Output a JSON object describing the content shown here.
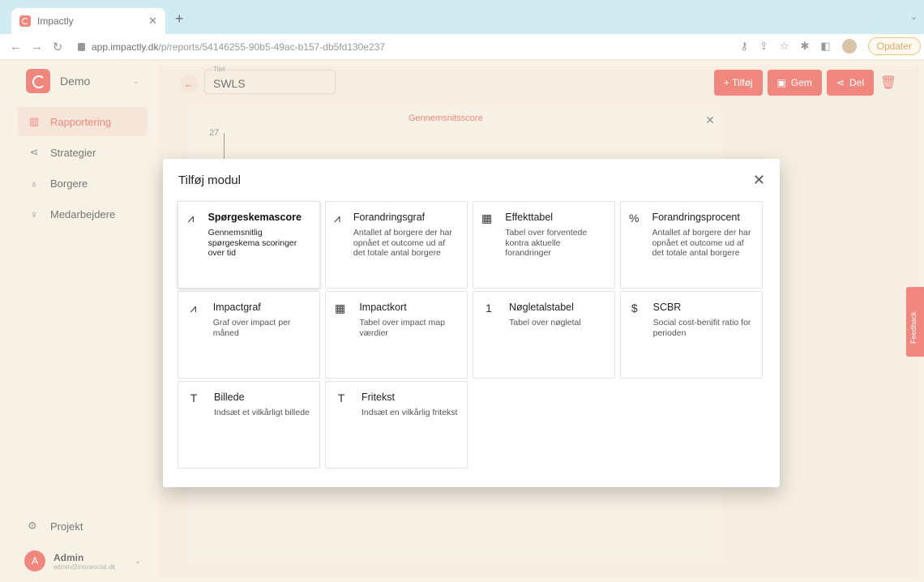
{
  "browser": {
    "tab_title": "Impactly",
    "url_host": "app.impactly.dk",
    "url_path": "/p/reports/54146255-90b5-49ac-b157-db5fd130e237",
    "update_label": "Opdater"
  },
  "sidebar": {
    "org_name": "Demo",
    "items": [
      {
        "label": "Rapportering",
        "icon": "report-icon"
      },
      {
        "label": "Strategier",
        "icon": "share-icon"
      },
      {
        "label": "Borgere",
        "icon": "people-icon"
      },
      {
        "label": "Medarbejdere",
        "icon": "user-icon"
      }
    ],
    "project_label": "Projekt",
    "user": {
      "initial": "A",
      "name": "Admin",
      "email": "admin@innosocial.dk"
    }
  },
  "header": {
    "title_label": "Titel",
    "title_value": "SWLS",
    "add_label": "+ Tilføj",
    "save_label": "Gem",
    "share_label": "Del"
  },
  "background_card": {
    "legend": "Gennemsnitsscore",
    "y_tick": "27"
  },
  "modal": {
    "title": "Tilføj modul",
    "modules": [
      {
        "title": "Spørgeskemascore",
        "desc": "Gennemsnitlig spørgeskema scoringer over tid",
        "icon": "line-chart-icon",
        "glyph": "⩘"
      },
      {
        "title": "Forandringsgraf",
        "desc": "Antallet af borgere der har opnået et outcome ud af det totale antal borgere",
        "icon": "line-chart-icon",
        "glyph": "⩘"
      },
      {
        "title": "Effekttabel",
        "desc": "Tabel over forventede kontra aktuelle forandringer",
        "icon": "table-icon",
        "glyph": "▦"
      },
      {
        "title": "Forandringsprocent",
        "desc": "Antallet af borgere der har opnået et outcome ud af det totale antal borgere",
        "icon": "percent-icon",
        "glyph": "%"
      },
      {
        "title": "Impactgraf",
        "desc": "Graf over impact per måned",
        "icon": "line-chart-icon",
        "glyph": "⩘"
      },
      {
        "title": "Impactkort",
        "desc": "Tabel over impact map værdier",
        "icon": "table-icon",
        "glyph": "▦"
      },
      {
        "title": "Nøgletalstabel",
        "desc": "Tabel over nøgletal",
        "icon": "number-one-icon",
        "glyph": "1"
      },
      {
        "title": "SCBR",
        "desc": "Social cost-benifit ratio for perioden",
        "icon": "dollar-icon",
        "glyph": "$"
      },
      {
        "title": "Billede",
        "desc": "Indsæt et vilkårligt billede",
        "icon": "text-box-icon",
        "glyph": "T"
      },
      {
        "title": "Fritekst",
        "desc": "Indsæt en vilkårlig fritekst",
        "icon": "text-box-icon",
        "glyph": "T"
      }
    ]
  },
  "feedback_label": "Feedback"
}
